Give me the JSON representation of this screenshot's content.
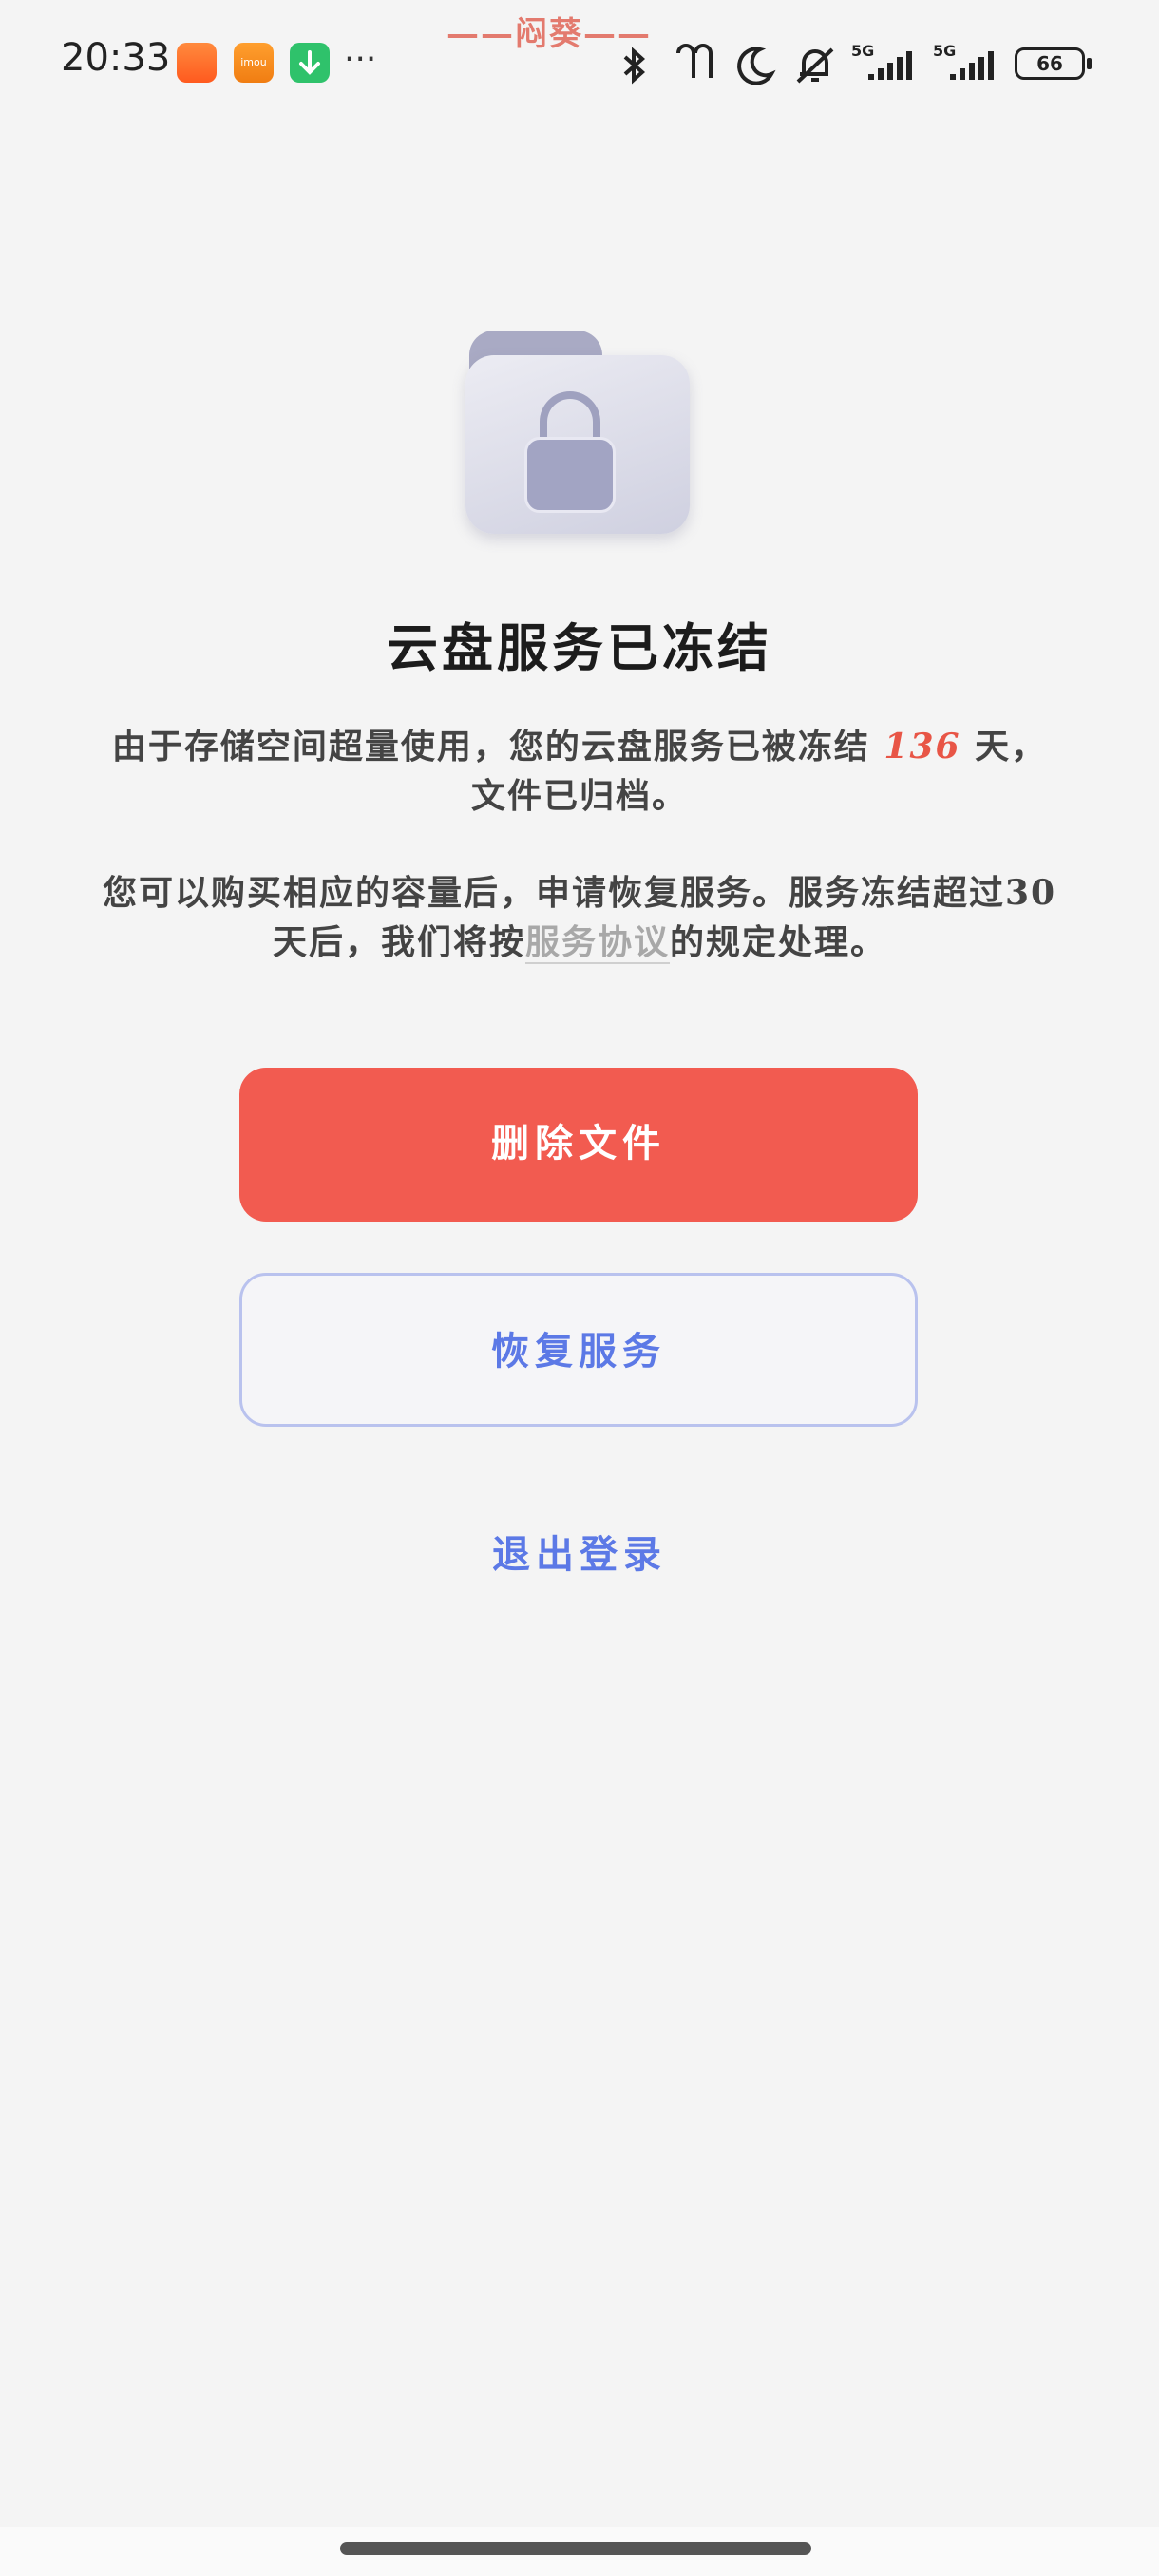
{
  "status_bar": {
    "time": "20:33",
    "watermark": "——闷葵——",
    "battery": "66",
    "network_labels": [
      "5G",
      "5G"
    ],
    "icons": [
      "shop-app-icon",
      "imou-app-icon",
      "download-app-icon",
      "more-icon",
      "bluetooth-icon",
      "earbuds-icon",
      "moon-icon",
      "mute-icon",
      "signal-icon",
      "signal-icon",
      "battery-icon"
    ]
  },
  "main": {
    "illustration": "locked-folder-icon",
    "title": "云盘服务已冻结",
    "desc1_before": "由于存储空间超量使用，您的云盘服务已被冻结",
    "days": "136",
    "desc1_after": "天，文件已归档。",
    "desc2_before": "您可以购买相应的容量后，申请恢复服务。服务冻结超过30天后，我们将按",
    "agreement_link": "服务协议",
    "desc2_after": "的规定处理。",
    "delete_button": "删除文件",
    "restore_button": "恢复服务",
    "logout_link": "退出登录"
  },
  "colors": {
    "accent_red": "#f25b50",
    "accent_blue": "#5c79e6",
    "days_highlight": "#e85546"
  }
}
